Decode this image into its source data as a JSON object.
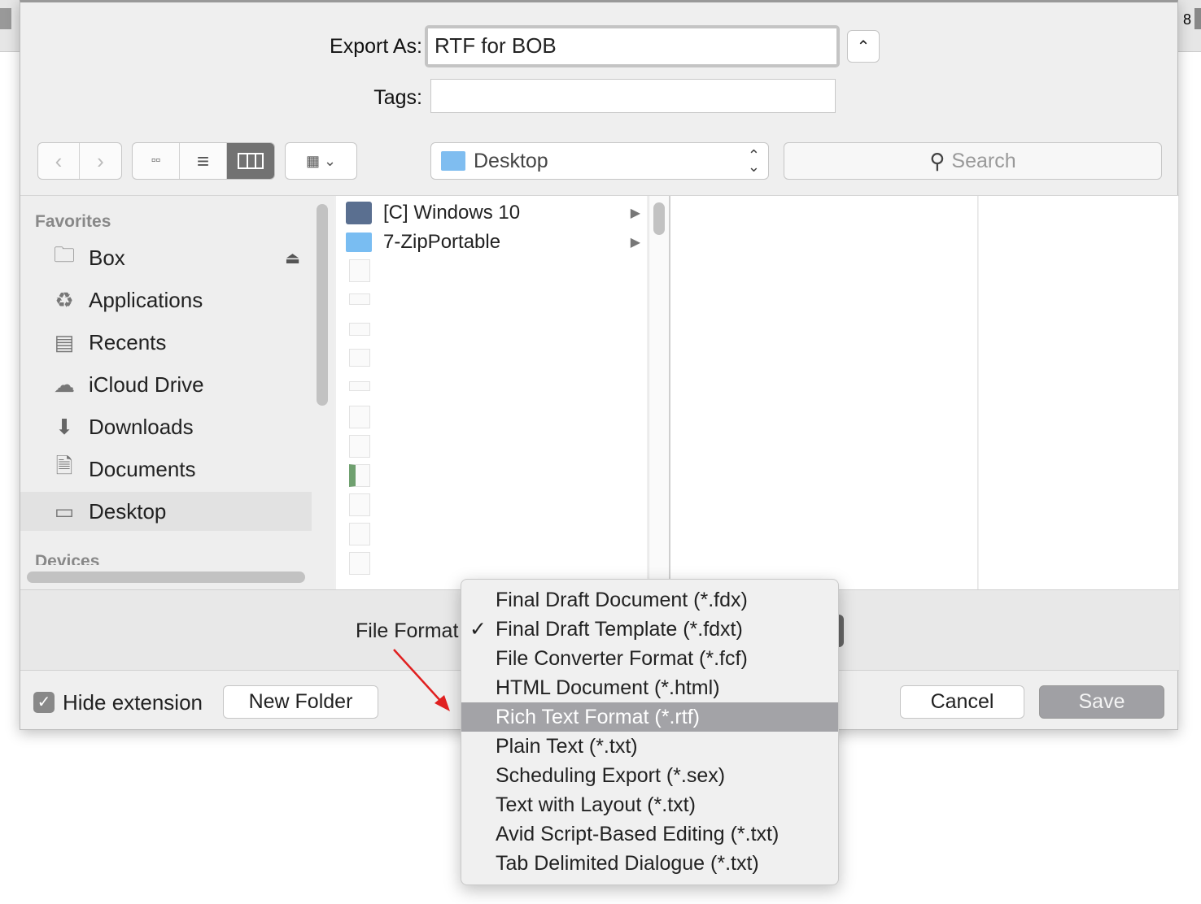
{
  "background": {
    "right_text": "8"
  },
  "header": {
    "export_as_label": "Export As:",
    "export_as_value": "RTF for BOB",
    "tags_label": "Tags:",
    "tags_value": ""
  },
  "toolbar": {
    "location": "Desktop",
    "search_placeholder": "Search",
    "view_modes": [
      "icon",
      "list",
      "column"
    ],
    "active_view": "column"
  },
  "sidebar": {
    "favorites_label": "Favorites",
    "items": [
      {
        "label": "Box",
        "icon": "folder-icon",
        "eject": true
      },
      {
        "label": "Applications",
        "icon": "applications-icon"
      },
      {
        "label": "Recents",
        "icon": "recents-icon"
      },
      {
        "label": "iCloud Drive",
        "icon": "cloud-icon"
      },
      {
        "label": "Downloads",
        "icon": "downloads-icon"
      },
      {
        "label": "Documents",
        "icon": "documents-icon"
      },
      {
        "label": "Desktop",
        "icon": "desktop-icon",
        "selected": true
      }
    ],
    "devices_label": "Devices"
  },
  "column1": {
    "items": [
      {
        "label": "[C] Windows 10",
        "icon": "drive-icon"
      },
      {
        "label": "7-ZipPortable",
        "icon": "folder-icon"
      }
    ]
  },
  "file_format": {
    "label": "File Format",
    "options": [
      "Final Draft Document (*.fdx)",
      "Final Draft Template (*.fdxt)",
      "File Converter Format (*.fcf)",
      "HTML Document (*.html)",
      "Rich Text Format (*.rtf)",
      "Plain Text (*.txt)",
      "Scheduling Export (*.sex)",
      "Text with Layout (*.txt)",
      "Avid Script-Based Editing (*.txt)",
      "Tab Delimited Dialogue (*.txt)"
    ],
    "checked": "Final Draft Template (*.fdxt)",
    "highlighted": "Rich Text Format (*.rtf)"
  },
  "footer": {
    "hide_extension_label": "Hide extension",
    "hide_extension_checked": true,
    "new_folder": "New Folder",
    "cancel": "Cancel",
    "save": "Save"
  },
  "colors": {
    "highlight": "#a3a3a7",
    "save_button": "#a0a0a4",
    "annotation_arrow": "#e02020"
  }
}
